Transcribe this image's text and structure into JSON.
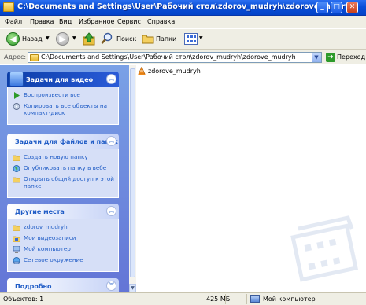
{
  "window": {
    "title": "C:\\Documents and Settings\\User\\Рабочий стол\\zdorov_mudryh\\zdorove_mudryh",
    "buttons": {
      "minimize": "_",
      "maximize": "□",
      "close": "✕"
    }
  },
  "menubar": [
    "Файл",
    "Правка",
    "Вид",
    "Избранное",
    "Сервис",
    "Справка"
  ],
  "toolbar": {
    "back_label": "Назад",
    "search_label": "Поиск",
    "folders_label": "Папки"
  },
  "address": {
    "label": "Адрес:",
    "value": "C:\\Documents and Settings\\User\\Рабочий стол\\zdorov_mudryh\\zdorove_mudryh",
    "go_label": "Переход"
  },
  "taskpane": {
    "video_tasks": {
      "title": "Задачи для видео",
      "items": [
        "Воспроизвести все",
        "Копировать все объекты на компакт-диск"
      ]
    },
    "file_tasks": {
      "title": "Задачи для файлов и папок",
      "items": [
        "Создать новую папку",
        "Опубликовать папку в вебе",
        "Открыть общий доступ к этой папке"
      ]
    },
    "other_places": {
      "title": "Другие места",
      "items": [
        "zdorov_mudryh",
        "Мои видеозаписи",
        "Мой компьютер",
        "Сетевое окружение"
      ]
    },
    "details": {
      "title": "Подробно"
    }
  },
  "files": [
    {
      "name": "zdorove_mudryh",
      "icon": "vlc-media-file-icon"
    }
  ],
  "statusbar": {
    "objects": "Объектов: 1",
    "size": "425 МБ",
    "location": "Мой компьютер"
  },
  "colors": {
    "titlebar": "#0a4fd8",
    "taskpane": "#7aa1e6",
    "panel_body": "#d6dff7",
    "link": "#215dc6"
  }
}
